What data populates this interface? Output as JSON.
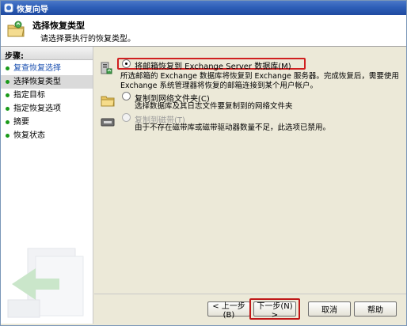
{
  "window": {
    "title": "恢复向导"
  },
  "header": {
    "title": "选择恢复类型",
    "subtitle": "请选择要执行的恢复类型。"
  },
  "sidebar": {
    "heading": "步骤:",
    "items": [
      {
        "label": "复查恢复选择",
        "state": "done"
      },
      {
        "label": "选择恢复类型",
        "state": "current"
      },
      {
        "label": "指定目标",
        "state": "pending"
      },
      {
        "label": "指定恢复选项",
        "state": "pending"
      },
      {
        "label": "摘要",
        "state": "pending"
      },
      {
        "label": "恢复状态",
        "state": "pending"
      }
    ]
  },
  "options": [
    {
      "label": "将邮箱恢复到 Exchange Server 数据库(M)",
      "desc_lines": [
        "所选邮箱的 Exchange 数据库将恢复到 Exchange 服务器。完成恢复后，需要使用",
        "Exchange 系统管理器将恢复的邮箱连接到某个用户帐户。"
      ],
      "checked": true,
      "enabled": true,
      "icon": "exchange-server-icon"
    },
    {
      "label": "复制到网络文件夹(C)",
      "desc_lines": [
        "选择数据库及其日志文件要复制到的网络文件夹"
      ],
      "checked": false,
      "enabled": true,
      "icon": "folder-icon"
    },
    {
      "label": "复制到磁带(T)",
      "desc_lines": [
        "由于不存在磁带库或磁带驱动器数量不足，此选项已禁用。"
      ],
      "checked": false,
      "enabled": false,
      "icon": "tape-drive-icon"
    }
  ],
  "buttons": {
    "back": "< 上一步(B)",
    "next": "下一步(N) >",
    "cancel": "取消",
    "help": "帮助"
  },
  "colors": {
    "titlebar": "#2e5fb8",
    "highlight": "#d02020",
    "step_done_dot": "#1a9a1a",
    "step_done_text": "#1a4fb0"
  }
}
